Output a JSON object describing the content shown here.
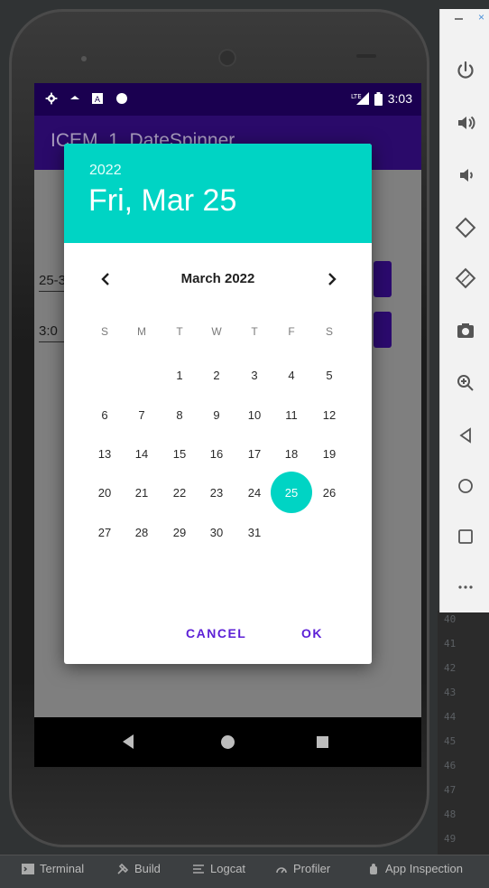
{
  "app": {
    "title": "ICEM_1_DateSpinner",
    "time": "3:03",
    "field_date_value": "25-3",
    "field_time_value": "3:0"
  },
  "dialog": {
    "year": "2022",
    "selected_date": "Fri, Mar 25",
    "month_label": "March 2022",
    "weekdays": [
      "S",
      "M",
      "T",
      "W",
      "T",
      "F",
      "S"
    ],
    "weeks": [
      [
        "",
        "",
        "1",
        "2",
        "3",
        "4",
        "5"
      ],
      [
        "6",
        "7",
        "8",
        "9",
        "10",
        "11",
        "12"
      ],
      [
        "13",
        "14",
        "15",
        "16",
        "17",
        "18",
        "19"
      ],
      [
        "20",
        "21",
        "22",
        "23",
        "24",
        "25",
        "26"
      ],
      [
        "27",
        "28",
        "29",
        "30",
        "31",
        "",
        ""
      ]
    ],
    "selected_day": "25",
    "cancel_label": "CANCEL",
    "ok_label": "OK",
    "accent_color": "#00d4c4",
    "button_color": "#5c1fd6"
  },
  "emulator_panel": {
    "buttons": [
      "power-icon",
      "volume-up-icon",
      "volume-down-icon",
      "rotate-left-icon",
      "rotate-right-icon",
      "camera-icon",
      "zoom-icon",
      "back-icon",
      "home-icon",
      "overview-icon",
      "more-icon"
    ]
  },
  "gutter_lines": [
    "40",
    "41",
    "42",
    "43",
    "44",
    "45",
    "46",
    "47",
    "48",
    "49"
  ],
  "toolbar": {
    "terminal": "Terminal",
    "build": "Build",
    "logcat": "Logcat",
    "profiler": "Profiler",
    "app_inspection": "App Inspection"
  }
}
